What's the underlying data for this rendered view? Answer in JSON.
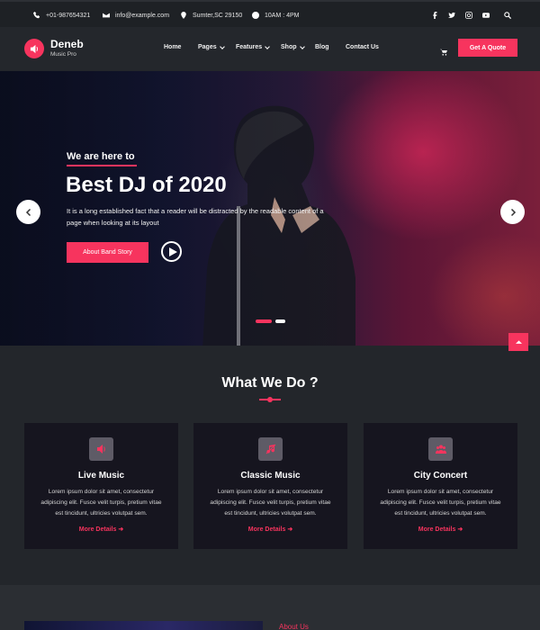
{
  "topbar": {
    "phone": "+01-987654321",
    "email": "info@example.com",
    "location": "Sumter,SC 29150",
    "hours": "10AM : 4PM"
  },
  "nav": {
    "brand": "Deneb",
    "tagline": "Music Pro",
    "items": [
      "Home",
      "Pages",
      "Features",
      "Shop",
      "Blog",
      "Contact Us"
    ],
    "cta": "Get A Quote"
  },
  "hero": {
    "kicker": "We are here to",
    "title": "Best DJ of 2020",
    "text": "It is a long established fact that a reader will be distracted by the readable content of a page when looking at its layout",
    "button": "About Band Story"
  },
  "services": {
    "title": "What We Do ?",
    "cards": [
      {
        "icon": "speaker-icon",
        "title": "Live Music",
        "text": "Lorem ipsum dolor sit amet, consectetur adipiscing elit. Fusce velit turpis, pretium vitae est tincidunt, ultricies volutpat sem.",
        "link": "More Details"
      },
      {
        "icon": "music-off-icon",
        "title": "Classic Music",
        "text": "Lorem ipsum dolor sit amet, consectetur adipiscing elit. Fusce velit turpis, pretium vitae est tincidunt, ultricies volutpat sem.",
        "link": "More Details"
      },
      {
        "icon": "people-icon",
        "title": "City Concert",
        "text": "Lorem ipsum dolor sit amet, consectetur adipiscing elit. Fusce velit turpis, pretium vitae est tincidunt, ultricies volutpat sem.",
        "link": "More Details"
      }
    ]
  },
  "about": {
    "label": "About Us"
  },
  "colors": {
    "accent": "#f7345e",
    "background": "#23262b",
    "card": "#16151f"
  }
}
